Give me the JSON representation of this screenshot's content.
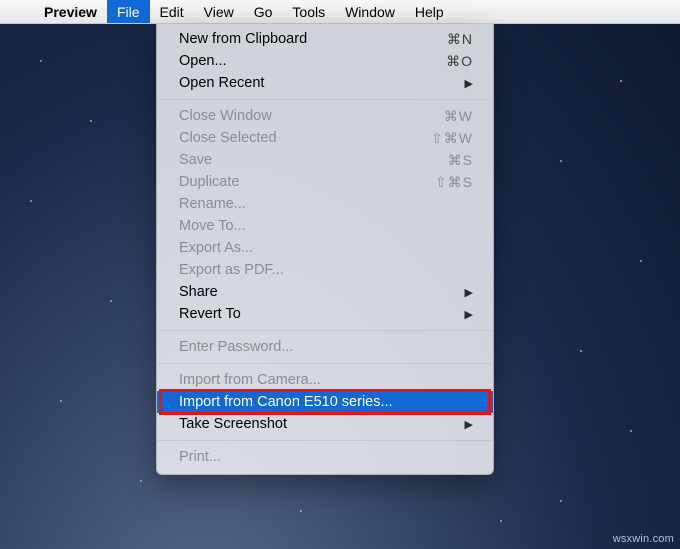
{
  "menubar": {
    "app_name": "Preview",
    "items": [
      "File",
      "Edit",
      "View",
      "Go",
      "Tools",
      "Window",
      "Help"
    ],
    "open_index": 0
  },
  "dropdown": {
    "groups": [
      [
        {
          "label": "New from Clipboard",
          "shortcut": "⌘N",
          "enabled": true,
          "submenu": false
        },
        {
          "label": "Open...",
          "shortcut": "⌘O",
          "enabled": true,
          "submenu": false
        },
        {
          "label": "Open Recent",
          "shortcut": "",
          "enabled": true,
          "submenu": true
        }
      ],
      [
        {
          "label": "Close Window",
          "shortcut": "⌘W",
          "enabled": false,
          "submenu": false
        },
        {
          "label": "Close Selected",
          "shortcut": "⇧⌘W",
          "enabled": false,
          "submenu": false
        },
        {
          "label": "Save",
          "shortcut": "⌘S",
          "enabled": false,
          "submenu": false
        },
        {
          "label": "Duplicate",
          "shortcut": "⇧⌘S",
          "enabled": false,
          "submenu": false
        },
        {
          "label": "Rename...",
          "shortcut": "",
          "enabled": false,
          "submenu": false
        },
        {
          "label": "Move To...",
          "shortcut": "",
          "enabled": false,
          "submenu": false
        },
        {
          "label": "Export As...",
          "shortcut": "",
          "enabled": false,
          "submenu": false
        },
        {
          "label": "Export as PDF...",
          "shortcut": "",
          "enabled": false,
          "submenu": false
        },
        {
          "label": "Share",
          "shortcut": "",
          "enabled": true,
          "submenu": true
        },
        {
          "label": "Revert To",
          "shortcut": "",
          "enabled": true,
          "submenu": true
        }
      ],
      [
        {
          "label": "Enter Password...",
          "shortcut": "",
          "enabled": false,
          "submenu": false
        }
      ],
      [
        {
          "label": "Import from Camera...",
          "shortcut": "",
          "enabled": false,
          "submenu": false
        },
        {
          "label": "Import from Canon E510 series...",
          "shortcut": "",
          "enabled": true,
          "submenu": false,
          "highlight": true,
          "annot": true
        },
        {
          "label": "Take Screenshot",
          "shortcut": "",
          "enabled": true,
          "submenu": true
        }
      ],
      [
        {
          "label": "Print...",
          "shortcut": "",
          "enabled": false,
          "submenu": false
        }
      ]
    ]
  },
  "watermark": "wsxwin.com",
  "colors": {
    "highlight": "#1069d5",
    "annotation": "#e11"
  }
}
